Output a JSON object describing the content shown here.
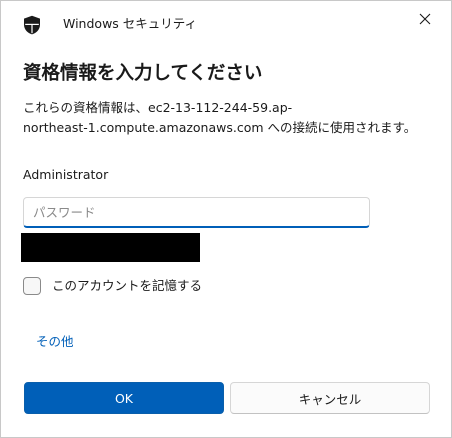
{
  "window": {
    "app_title": "Windows セキュリティ",
    "close_icon": "close-icon",
    "shield_icon": "shield-icon"
  },
  "dialog": {
    "heading": "資格情報を入力してください",
    "message_line1": "これらの資格情報は、ec2-13-112-244-59.ap-",
    "message_line2": "northeast-1.compute.amazonaws.com への接続に使用されます。",
    "username": "Administrator",
    "password_value": "",
    "password_placeholder": "パスワード",
    "remember_label": "このアカウントを記憶する",
    "remember_checked": false,
    "more_link": "その他",
    "ok_label": "OK",
    "cancel_label": "キャンセル"
  },
  "colors": {
    "accent": "#005fb8",
    "redaction": "#000000"
  }
}
